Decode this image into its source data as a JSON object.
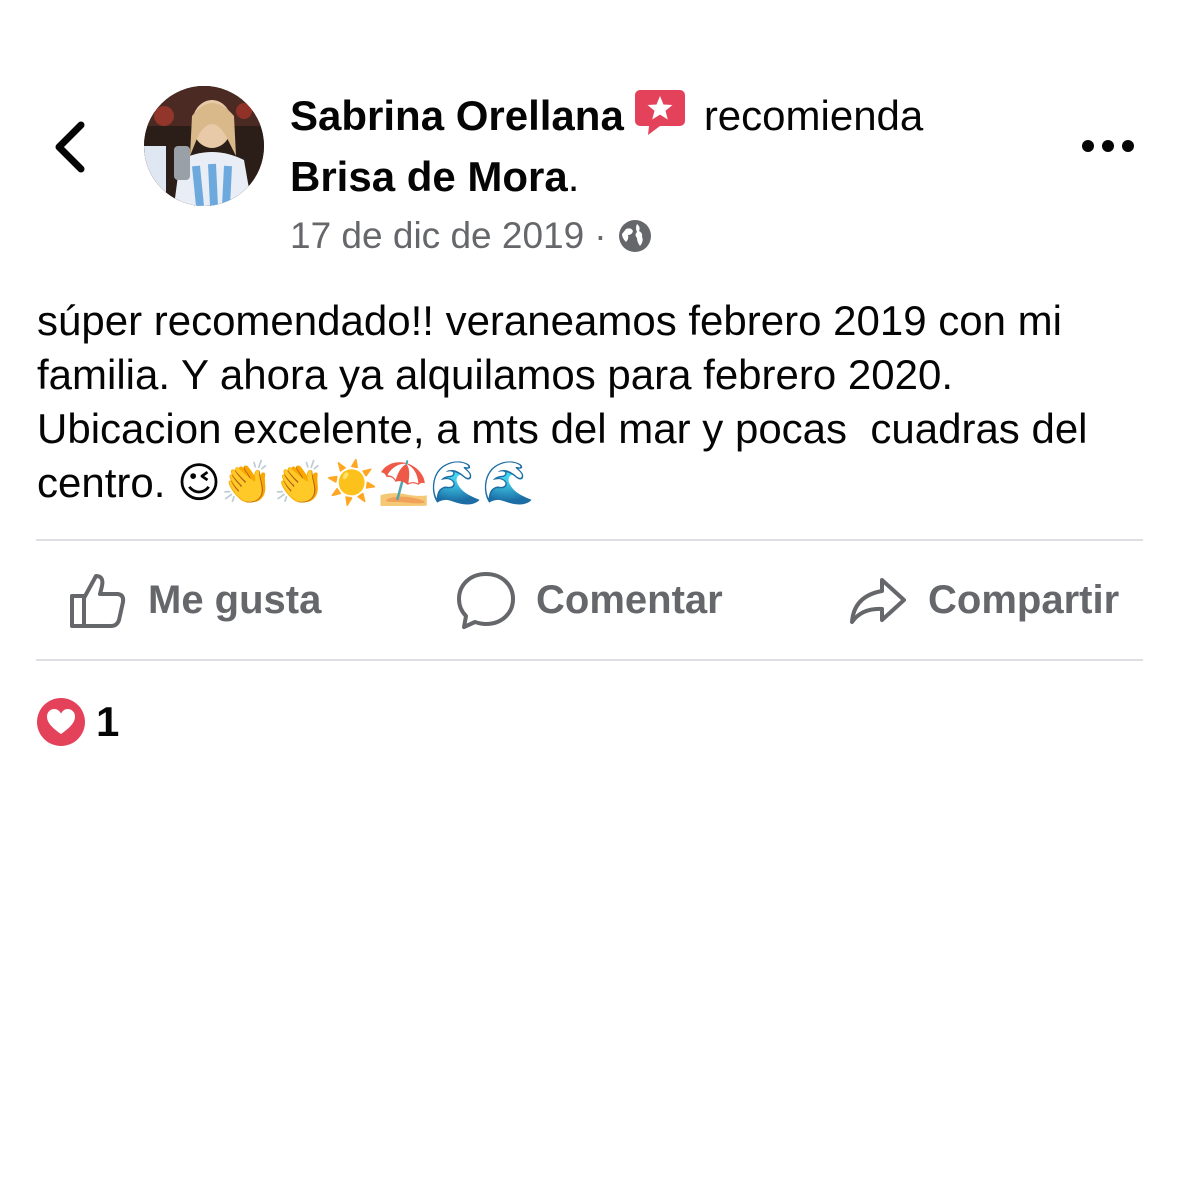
{
  "post": {
    "author_name": "Sabrina Orellana",
    "action_word": "recomienda",
    "page_name": "Brisa de Mora",
    "page_suffix": ".",
    "date": "17 de dic de 2019",
    "separator": "·",
    "privacy_icon": "globe-icon",
    "text": "súper recomendado!! veraneamos febrero 2019 con mi familia. Y ahora ya alquilamos para febrero 2020. Ubicacion excelente, a mts del mar y pocas  cuadras del centro. 😉👏👏☀️⛱️🌊🌊"
  },
  "actions": {
    "like_label": "Me gusta",
    "comment_label": "Comentar",
    "share_label": "Compartir"
  },
  "reactions": {
    "icon": "heart-icon",
    "count": "1"
  },
  "colors": {
    "badge_red": "#e3425a",
    "secondary_text": "#65676b",
    "divider": "#dddfe2"
  }
}
